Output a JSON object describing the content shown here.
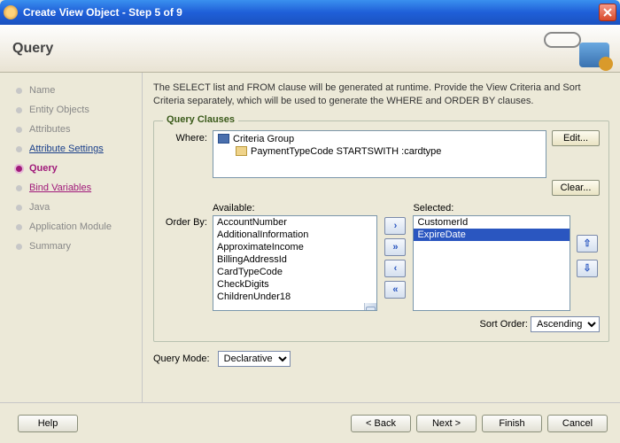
{
  "window": {
    "title": "Create View Object - Step 5 of 9"
  },
  "header": {
    "title": "Query"
  },
  "nav": {
    "items": [
      {
        "label": "Name",
        "state": "dim"
      },
      {
        "label": "Entity Objects",
        "state": "dim"
      },
      {
        "label": "Attributes",
        "state": "dim"
      },
      {
        "label": "Attribute Settings",
        "state": "link"
      },
      {
        "label": "Query",
        "state": "current"
      },
      {
        "label": "Bind Variables",
        "state": "link-visited"
      },
      {
        "label": "Java",
        "state": "dim"
      },
      {
        "label": "Application Module",
        "state": "dim"
      },
      {
        "label": "Summary",
        "state": "dim"
      }
    ]
  },
  "intro": "The SELECT list and FROM clause will be generated at runtime.  Provide the View Criteria and Sort Criteria separately, which will be used to generate the WHERE and ORDER BY clauses.",
  "clauses": {
    "legend": "Query Clauses",
    "where_label": "Where:",
    "tree_root": "Criteria Group",
    "tree_child": "PaymentTypeCode STARTSWITH :cardtype",
    "edit": "Edit...",
    "clear": "Clear...",
    "orderby_label": "Order By:",
    "available_label": "Available:",
    "selected_label": "Selected:",
    "available": [
      "AccountNumber",
      "AdditionalInformation",
      "ApproximateIncome",
      "BillingAddressId",
      "CardTypeCode",
      "CheckDigits",
      "ChildrenUnder18"
    ],
    "selected": [
      "CustomerId",
      "ExpireDate"
    ],
    "selected_index": 1,
    "sort_label": "Sort Order:",
    "sort_value": "Ascending"
  },
  "query_mode": {
    "label": "Query Mode:",
    "value": "Declarative"
  },
  "footer": {
    "help": "Help",
    "back": "< Back",
    "next": "Next >",
    "finish": "Finish",
    "cancel": "Cancel"
  }
}
